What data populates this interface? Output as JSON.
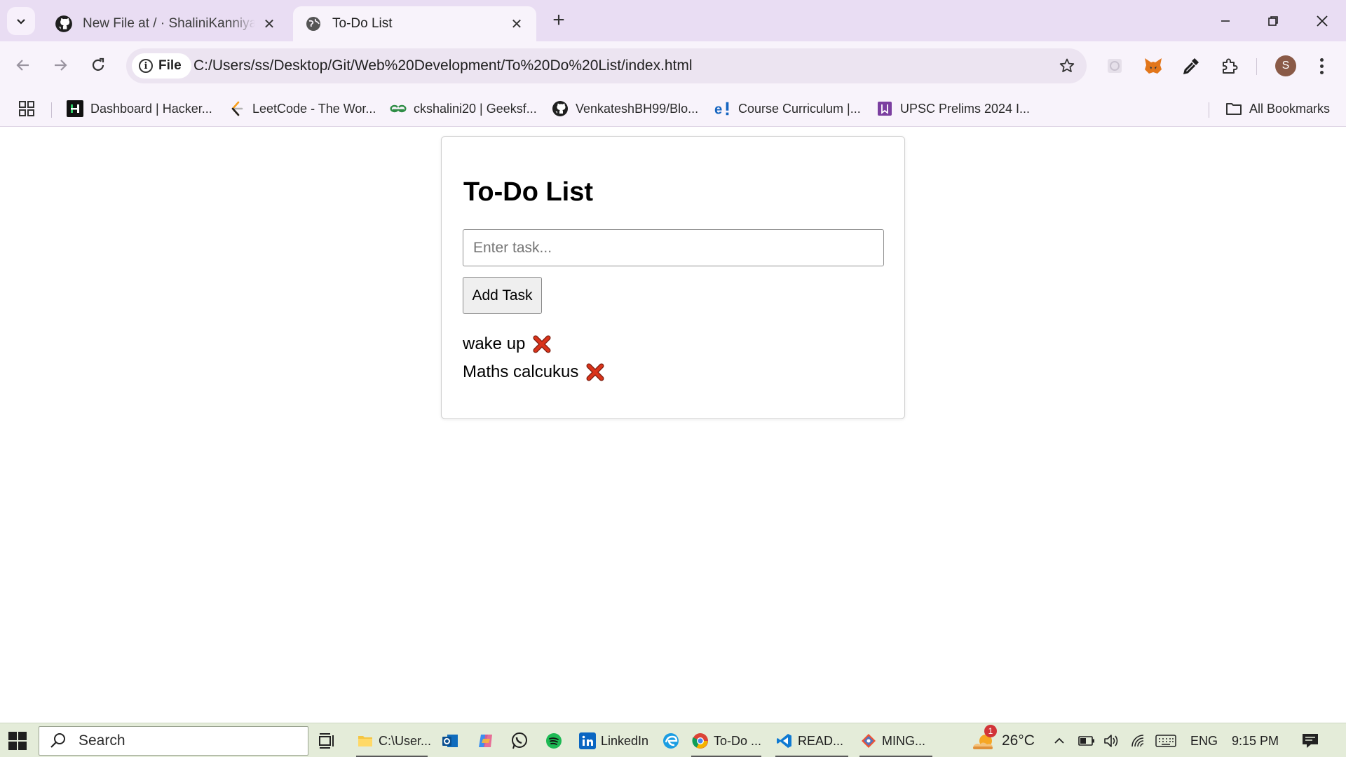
{
  "browser": {
    "tabs": [
      {
        "label": "New File at / · ShaliniKanniyappan",
        "icon": "github-icon",
        "active": false
      },
      {
        "label": "To-Do List",
        "icon": "globe-icon",
        "active": true
      }
    ],
    "address": {
      "chip_label": "File",
      "url": "C:/Users/ss/Desktop/Git/Web%20Development/To%20Do%20List/index.html"
    },
    "bookmarks": [
      {
        "label": "Dashboard | Hacker...",
        "icon": "hackerrank-icon"
      },
      {
        "label": "LeetCode - The Wor...",
        "icon": "leetcode-icon"
      },
      {
        "label": "ckshalini20 | Geeksf...",
        "icon": "geeksforgeeks-icon"
      },
      {
        "label": "VenkateshBH99/Blo...",
        "icon": "github-icon"
      },
      {
        "label": "Course Curriculum |...",
        "icon": "edureka-icon"
      },
      {
        "label": "UPSC Prelims 2024 I...",
        "icon": "book-icon"
      }
    ],
    "all_bookmarks_label": "All Bookmarks",
    "profile_initial": "S"
  },
  "page": {
    "heading": "To-Do List",
    "input_placeholder": "Enter task...",
    "input_value": "",
    "add_button_label": "Add Task",
    "tasks": [
      {
        "text": "wake up"
      },
      {
        "text": "Maths calcukus"
      }
    ]
  },
  "taskbar": {
    "search_label": "Search",
    "apps": [
      {
        "label": "C:\\User...",
        "icon": "file-explorer-icon"
      },
      {
        "label": "",
        "icon": "outlook-icon"
      },
      {
        "label": "",
        "icon": "copilot-icon"
      },
      {
        "label": "",
        "icon": "whatsapp-icon"
      },
      {
        "label": "",
        "icon": "spotify-icon"
      },
      {
        "label": "LinkedIn",
        "icon": "linkedin-icon"
      },
      {
        "label": "",
        "icon": "edge-icon"
      },
      {
        "label": "To-Do ...",
        "icon": "chrome-icon"
      },
      {
        "label": "READ...",
        "icon": "vscode-icon"
      },
      {
        "label": "MING...",
        "icon": "git-bash-icon"
      }
    ],
    "weather": {
      "temp": "26°C",
      "badge": "1"
    },
    "language": "ENG",
    "time": "9:15 PM"
  },
  "colors": {
    "tabbar_bg": "#e9ddf3",
    "toolbar_bg": "#f8f3fb",
    "taskbar_bg": "#e4ecd9",
    "delete_red": "#d9331a"
  }
}
